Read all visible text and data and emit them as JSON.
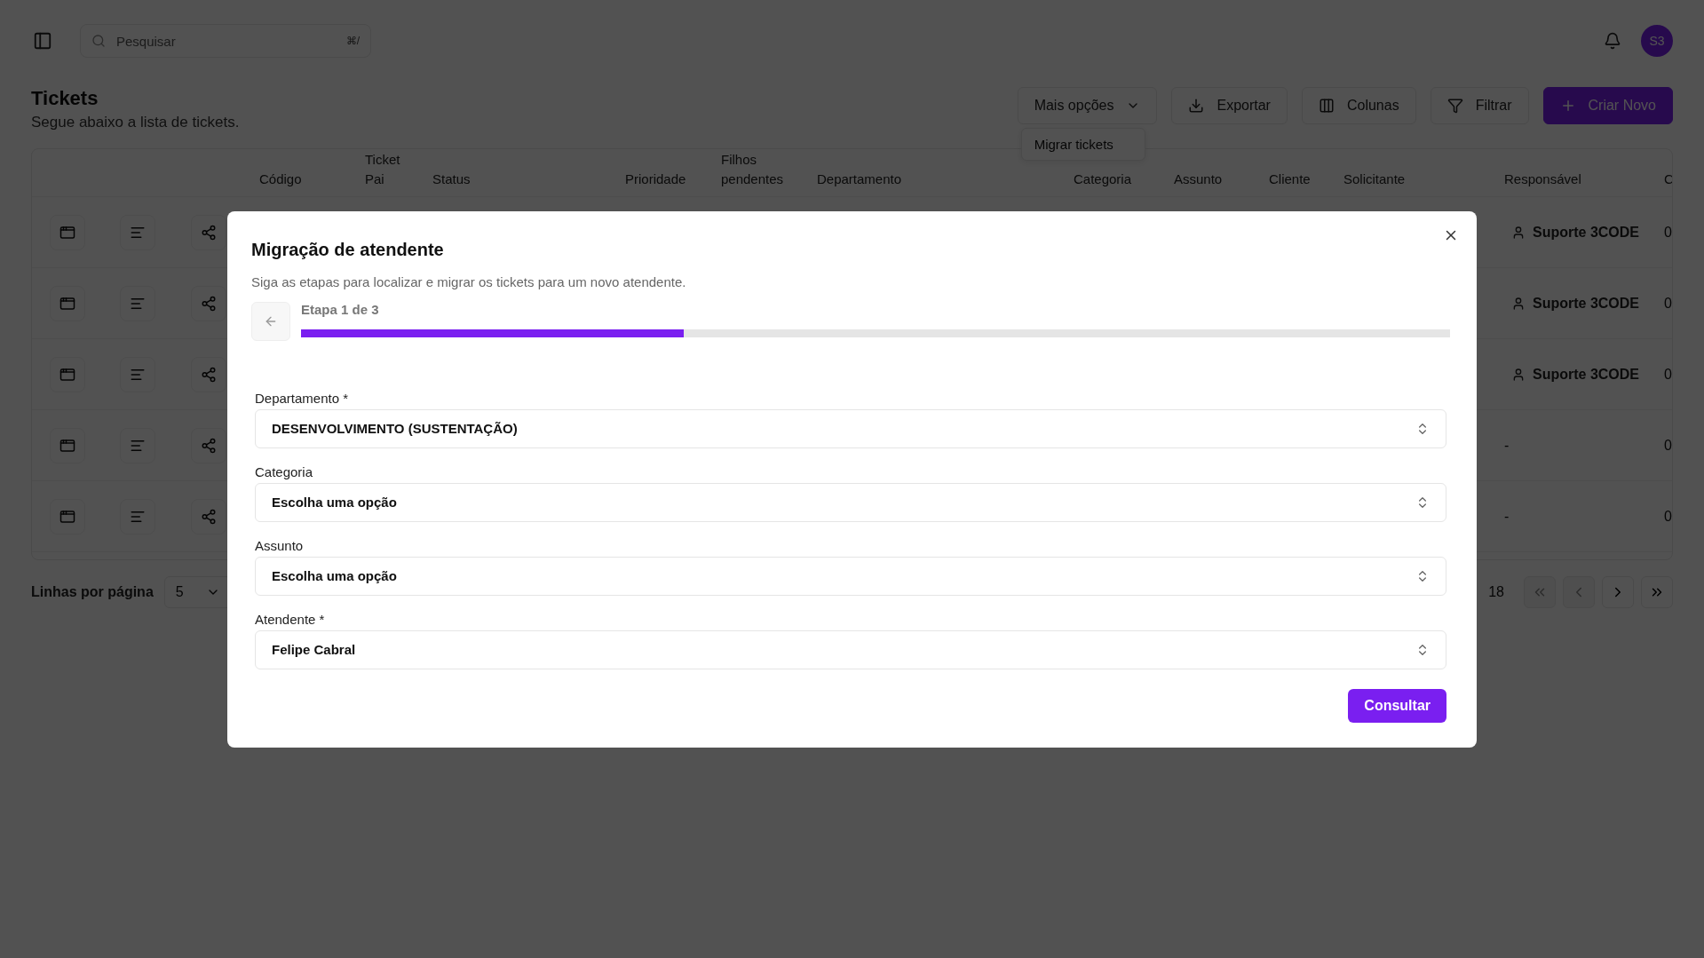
{
  "topbar": {
    "search_placeholder": "Pesquisar",
    "search_shortcut": "⌘/",
    "avatar": "S3"
  },
  "header": {
    "title": "Tickets",
    "subtitle": "Segue abaixo a lista de tickets."
  },
  "actions": [
    {
      "label": "Mais opções",
      "kind": "dropdown"
    },
    {
      "label": "Exportar",
      "kind": "export"
    },
    {
      "label": "Colunas",
      "kind": "columns"
    },
    {
      "label": "Filtrar",
      "kind": "filter"
    },
    {
      "label": "Criar Novo",
      "kind": "primary"
    }
  ],
  "menu": {
    "items": [
      "Migrar tickets"
    ]
  },
  "table": {
    "columns": [
      "Código",
      "Ticket Pai",
      "Status",
      "Prioridade",
      "Filhos pendentes",
      "Departamento",
      "Categoria",
      "Assunto",
      "Cliente",
      "Solicitante",
      "Responsável",
      "C"
    ],
    "rows": [
      {
        "responsavel": "Suporte 3CODE",
        "assigned": true,
        "column_13": "0"
      },
      {
        "responsavel": "Suporte 3CODE",
        "assigned": true,
        "column_13": "0"
      },
      {
        "responsavel": "Suporte 3CODE",
        "assigned": true,
        "column_13": "0"
      },
      {
        "responsavel": "-",
        "assigned": false,
        "column_13": "0"
      },
      {
        "responsavel": "-",
        "assigned": false,
        "column_13": "0"
      }
    ]
  },
  "pagination": {
    "rows_label": "Linhas por página",
    "rows_value": "5",
    "page_text": "18",
    "buttons": [
      {
        "kind": "first",
        "disabled": true
      },
      {
        "kind": "prev",
        "disabled": true
      },
      {
        "kind": "next",
        "disabled": false
      },
      {
        "kind": "last",
        "disabled": false
      }
    ]
  },
  "modal": {
    "title": "Migração de atendente",
    "description": "Siga as etapas para localizar e migrar os tickets para um novo atendente.",
    "step": "Etapa 1 de 3",
    "level": 0.333,
    "fields": [
      {
        "label": "Departamento *",
        "value": "DESENVOLVIMENTO (SUSTENTAÇÃO)"
      },
      {
        "label": "Categoria",
        "value": "Escolha uma opção"
      },
      {
        "label": "Assunto",
        "value": "Escolha uma opção"
      },
      {
        "label": "Atendente *",
        "value": "Felipe Cabral"
      }
    ],
    "submit": "Consultar"
  }
}
